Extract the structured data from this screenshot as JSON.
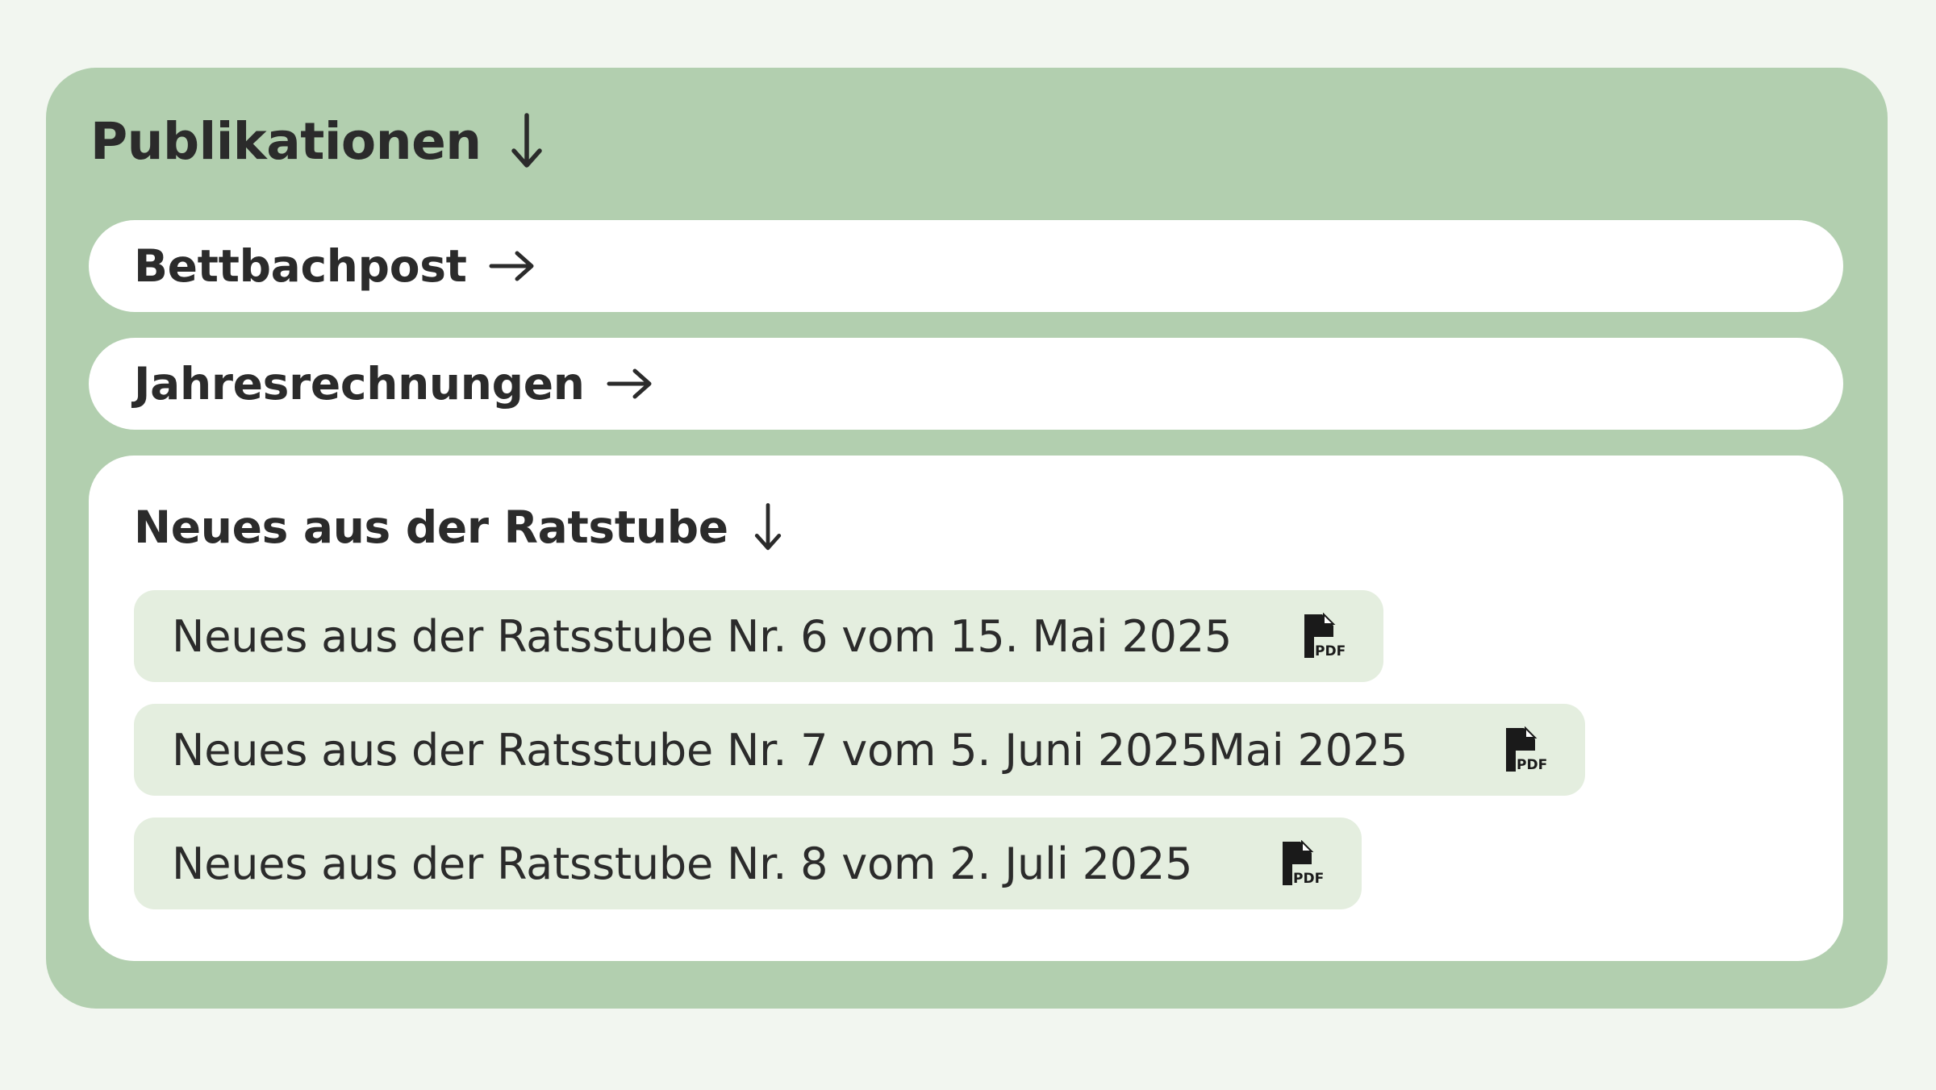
{
  "publications": {
    "title": "Publikationen",
    "links": [
      {
        "label": "Bettbachpost"
      },
      {
        "label": "Jahresrechnungen"
      }
    ],
    "section": {
      "title": "Neues aus der Ratstube",
      "documents": [
        {
          "label": "Neues aus der Ratsstube Nr. 6 vom 15. Mai 2025",
          "icon": "pdf-icon"
        },
        {
          "label": "Neues aus der Ratsstube Nr. 7 vom 5. Juni 2025Mai 2025",
          "icon": "pdf-icon"
        },
        {
          "label": "Neues aus der Ratsstube Nr. 8 vom 2. Juli 2025",
          "icon": "pdf-icon"
        }
      ]
    }
  },
  "colors": {
    "background": "#f2f6f0",
    "panel": "#b2cfaf",
    "card": "#ffffff",
    "doc_item": "#e4eedf",
    "text": "#2b2b2b"
  }
}
